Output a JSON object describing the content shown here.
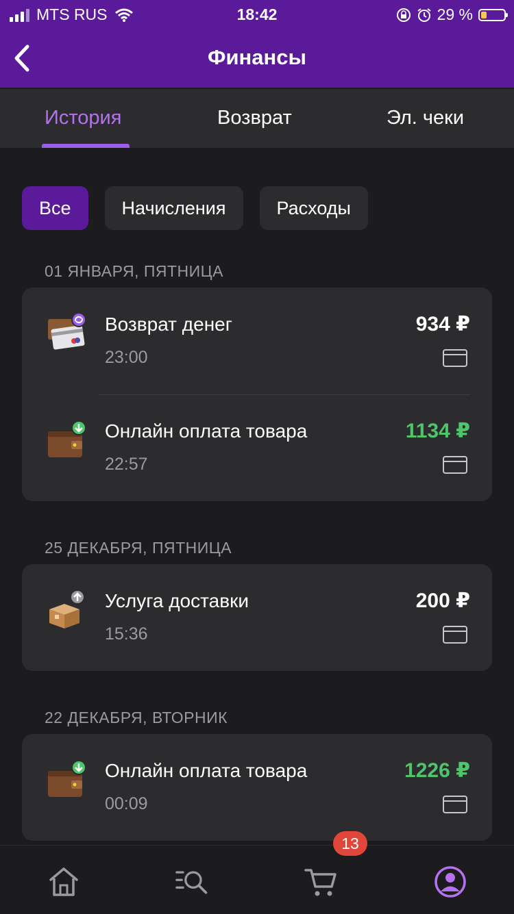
{
  "status_bar": {
    "carrier": "MTS RUS",
    "time": "18:42",
    "battery_percent": "29 %"
  },
  "header": {
    "title": "Финансы"
  },
  "tabs": [
    {
      "label": "История",
      "active": true
    },
    {
      "label": "Возврат",
      "active": false
    },
    {
      "label": "Эл. чеки",
      "active": false
    }
  ],
  "filters": [
    {
      "label": "Все",
      "active": true
    },
    {
      "label": "Начисления",
      "active": false
    },
    {
      "label": "Расходы",
      "active": false
    }
  ],
  "sections": [
    {
      "date": "01 ЯНВАРЯ, ПЯТНИЦА",
      "items": [
        {
          "name": "Возврат денег",
          "time": "23:00",
          "amount": "934 ₽",
          "icon": "refund-card-icon",
          "amount_color": "#ffffff"
        },
        {
          "name": "Онлайн оплата товара",
          "time": "22:57",
          "amount": "1134 ₽",
          "icon": "wallet-income-icon",
          "amount_color": "#4fc56b"
        }
      ]
    },
    {
      "date": "25 ДЕКАБРЯ, ПЯТНИЦА",
      "items": [
        {
          "name": "Услуга доставки",
          "time": "15:36",
          "amount": "200 ₽",
          "icon": "delivery-box-icon",
          "amount_color": "#ffffff"
        }
      ]
    },
    {
      "date": "22 ДЕКАБРЯ, ВТОРНИК",
      "items": [
        {
          "name": "Онлайн оплата товара",
          "time": "00:09",
          "amount": "1226 ₽",
          "icon": "wallet-income-icon",
          "amount_color": "#4fc56b"
        }
      ]
    }
  ],
  "bottom_nav": {
    "cart_badge": "13",
    "items": [
      "home-icon",
      "catalog-search-icon",
      "cart-icon",
      "profile-icon"
    ]
  },
  "colors": {
    "brand": "#5a1a9a",
    "accent": "#b571f1",
    "positive": "#4fc56b",
    "badge": "#e0463a"
  }
}
